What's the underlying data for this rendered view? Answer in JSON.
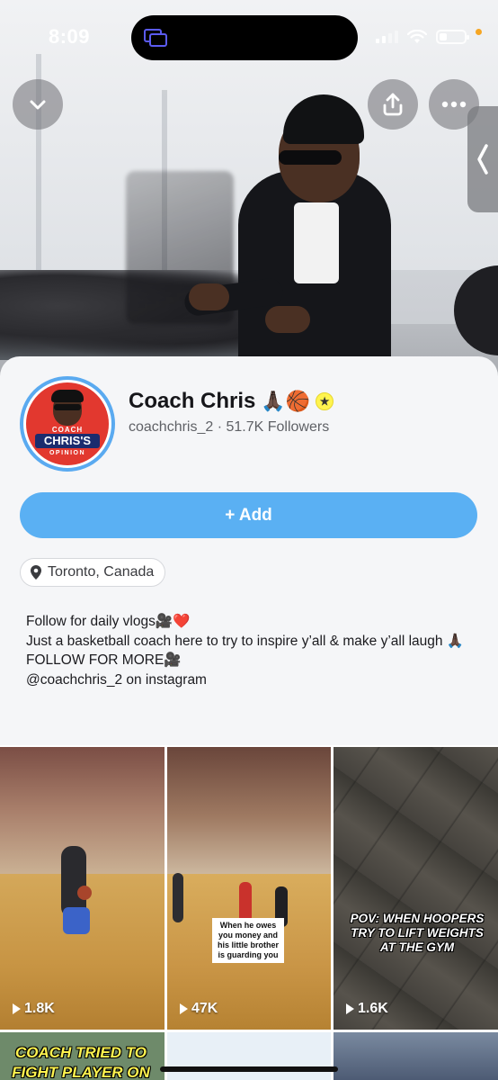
{
  "status_bar": {
    "time": "8:09"
  },
  "profile": {
    "name": "Coach Chris",
    "name_emoji": "🙏🏿🏀",
    "handle_line": "coachchris_2 · 51.7K Followers",
    "avatar_text": {
      "line1": "COACH",
      "line2": "CHRIS'S",
      "line3": "OPINION"
    },
    "add_button_label": "+ Add",
    "location": "Toronto, Canada",
    "bio_lines": [
      "Follow for daily vlogs🎥❤️",
      "Just a basketball coach  here to try to inspire y’all & make y’all laugh 🙏🏿",
      "FOLLOW FOR MORE🎥",
      "@coachchris_2 on instagram"
    ]
  },
  "grid": {
    "tiles": [
      {
        "views": "1.8K",
        "caption": ""
      },
      {
        "views": "47K",
        "caption": "When he owes you money and his little brother is guarding you"
      },
      {
        "views": "1.6K",
        "caption": "POV: WHEN HOOPERS TRY TO LIFT WEIGHTS AT THE GYM"
      }
    ],
    "row2_first_caption": "COACH TRIED TO FIGHT PLAYER ON"
  },
  "colors": {
    "accent": "#5ab0f3",
    "avatar_ring": "#5aaaf0",
    "card_bg": "#f5f6f8"
  },
  "icons": [
    "chevron-down-icon",
    "share-icon",
    "more-icon",
    "chevron-left-icon",
    "location-pin-icon",
    "play-icon",
    "star-badge-icon"
  ]
}
